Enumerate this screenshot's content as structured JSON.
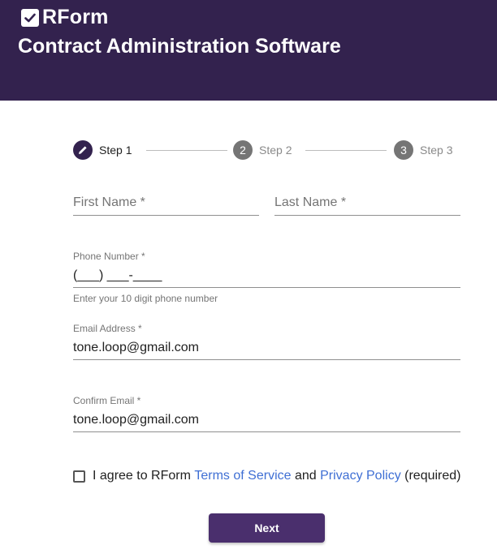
{
  "header": {
    "brand_name": "RForm",
    "app_title": "Contract Administration Software",
    "background_color": "#33224e"
  },
  "stepper": {
    "steps": [
      {
        "label": "Step 1",
        "indicator": "pencil-icon",
        "state": "active"
      },
      {
        "label": "Step 2",
        "indicator": "2",
        "state": "inactive"
      },
      {
        "label": "Step 3",
        "indicator": "3",
        "state": "inactive"
      }
    ]
  },
  "form": {
    "first_name": {
      "placeholder": "First Name *",
      "value": ""
    },
    "last_name": {
      "placeholder": "Last Name *",
      "value": ""
    },
    "phone": {
      "label": "Phone Number *",
      "value": "(___) ___-____",
      "helper": "Enter your 10 digit phone number"
    },
    "email": {
      "label": "Email Address *",
      "value": "tone.loop@gmail.com"
    },
    "confirm_email": {
      "label": "Confirm Email *",
      "value": "tone.loop@gmail.com"
    },
    "agree": {
      "checked": false,
      "prefix": "I agree to RForm ",
      "terms_link": "Terms of Service",
      "middle": " and ",
      "privacy_link": "Privacy Policy",
      "suffix": " (required)"
    }
  },
  "actions": {
    "next_label": "Next",
    "accent_color": "#4a2f6d",
    "link_color": "#3f6fd4"
  }
}
